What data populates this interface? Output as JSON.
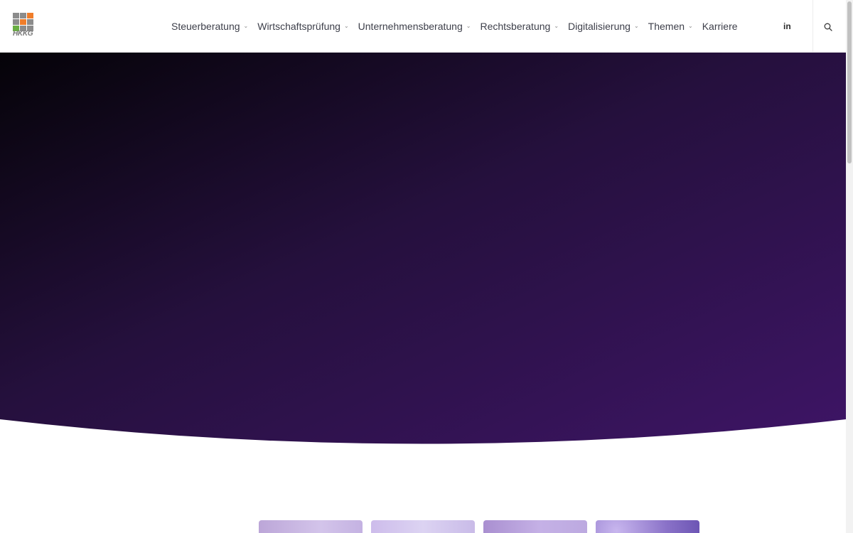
{
  "header": {
    "logo_text": "HKKG",
    "logo_colors": [
      "#8c8c8c",
      "#8c8c8c",
      "#f07d2a",
      "#8c8c8c",
      "#f07d2a",
      "#8c8c8c",
      "#6aae43",
      "#8c8c8c",
      "#8c8c8c"
    ],
    "nav": [
      {
        "label": "Steuerberatung",
        "has_dropdown": true
      },
      {
        "label": "Wirtschaftsprüfung",
        "has_dropdown": true
      },
      {
        "label": "Unternehmensberatung",
        "has_dropdown": true
      },
      {
        "label": "Rechtsberatung",
        "has_dropdown": true
      },
      {
        "label": "Digitalisierung",
        "has_dropdown": true
      },
      {
        "label": "Themen",
        "has_dropdown": true
      },
      {
        "label": "Karriere",
        "has_dropdown": false
      }
    ],
    "chevron_glyph": "⌄",
    "linkedin_label": "in",
    "search_icon": "search-icon"
  },
  "hero": {
    "gradient_start": "#050308",
    "gradient_end": "#3e1566"
  },
  "cards": [
    {
      "name": "card-1"
    },
    {
      "name": "card-2"
    },
    {
      "name": "card-3"
    },
    {
      "name": "card-4"
    }
  ]
}
